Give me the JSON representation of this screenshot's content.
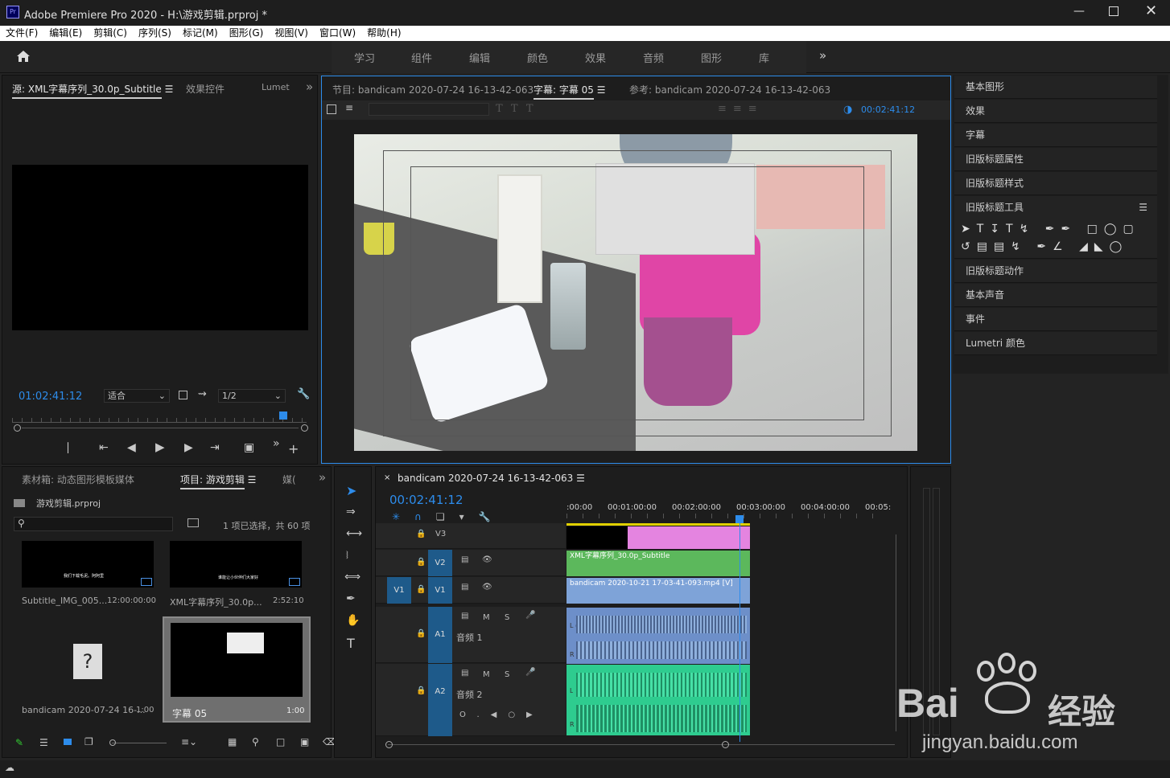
{
  "window": {
    "title": "Adobe Premiere Pro 2020 - H:\\游戏剪辑.prproj *",
    "app_icon": "Pr"
  },
  "menu": [
    "文件(F)",
    "编辑(E)",
    "剪辑(C)",
    "序列(S)",
    "标记(M)",
    "图形(G)",
    "视图(V)",
    "窗口(W)",
    "帮助(H)"
  ],
  "workspaces": [
    "学习",
    "组件",
    "编辑",
    "颜色",
    "效果",
    "音频",
    "图形",
    "库"
  ],
  "source": {
    "tab_source": "源: XML字幕序列_30.0p_Subtitle",
    "tab_effects": "效果控件",
    "tab_lumetri": "Lumet",
    "timecode": "01:02:41:12",
    "fit": "适合",
    "res": "1/2"
  },
  "program": {
    "tab_program": "节目: bandicam 2020-07-24 16-13-42-063",
    "tab_caption": "字幕: 字幕 05",
    "tab_ref": "参考: bandicam 2020-07-24 16-13-42-063",
    "timecode": "00:02:41:12"
  },
  "right_panels": [
    "基本图形",
    "效果",
    "字幕",
    "旧版标题属性",
    "旧版标题样式",
    "旧版标题工具",
    "旧版标题动作",
    "基本声音",
    "事件",
    "Lumetri 颜色"
  ],
  "project": {
    "tab_bin": "素材箱: 动态图形模板媒体",
    "tab_project": "项目: 游戏剪辑",
    "tab_more": "媒(",
    "file": "游戏剪辑.prproj",
    "selection": "1 项已选择，共 60 项",
    "items": [
      {
        "name": "Subtitle_IMG_005...",
        "dur": "12:00:00:00",
        "thumb_text": "我们下载毛泥。阿阿里"
      },
      {
        "name": "XML字幕序列_30.0p...",
        "dur": "2:52:10",
        "thumb_text": "谁能让小伙伴们大家好"
      },
      {
        "name": "bandicam 2020-07-24 16-...",
        "dur": "1:00"
      },
      {
        "name": "字幕 05",
        "dur": "1:00"
      }
    ]
  },
  "timeline": {
    "seq_name": "bandicam 2020-07-24 16-13-42-063",
    "timecode": "00:02:41:12",
    "ruler": [
      ":00:00",
      "00:01:00:00",
      "00:02:00:00",
      "00:03:00:00",
      "00:04:00:00",
      "00:05:"
    ],
    "tracks": {
      "v3": "V3",
      "v2": "V2",
      "v1": "V1",
      "v1src": "V1",
      "a1": "A1",
      "a1name": "音频 1",
      "a2": "A2",
      "a2name": "音频 2"
    },
    "clip_v2": "XML字幕序列_30.0p_Subtitle",
    "clip_v1": "bandicam 2020-10-21 17-03-41-093.mp4 [V]",
    "ms": {
      "m": "M",
      "s": "S"
    },
    "lr": {
      "l": "L",
      "r": "R",
      "l1": "L (1)",
      "r1": "R (1)"
    }
  },
  "watermark": {
    "brand": "Bai",
    "brand2": "经验",
    "url": "jingyan.baidu.com"
  },
  "colors": {
    "accent": "#2d8ceb",
    "v2clip": "#5cb85c",
    "v1clip": "#7ea3d8",
    "a1clip": "#6d8fc9",
    "a2clip": "#2ecc8f",
    "v3pink": "#e484e0"
  }
}
